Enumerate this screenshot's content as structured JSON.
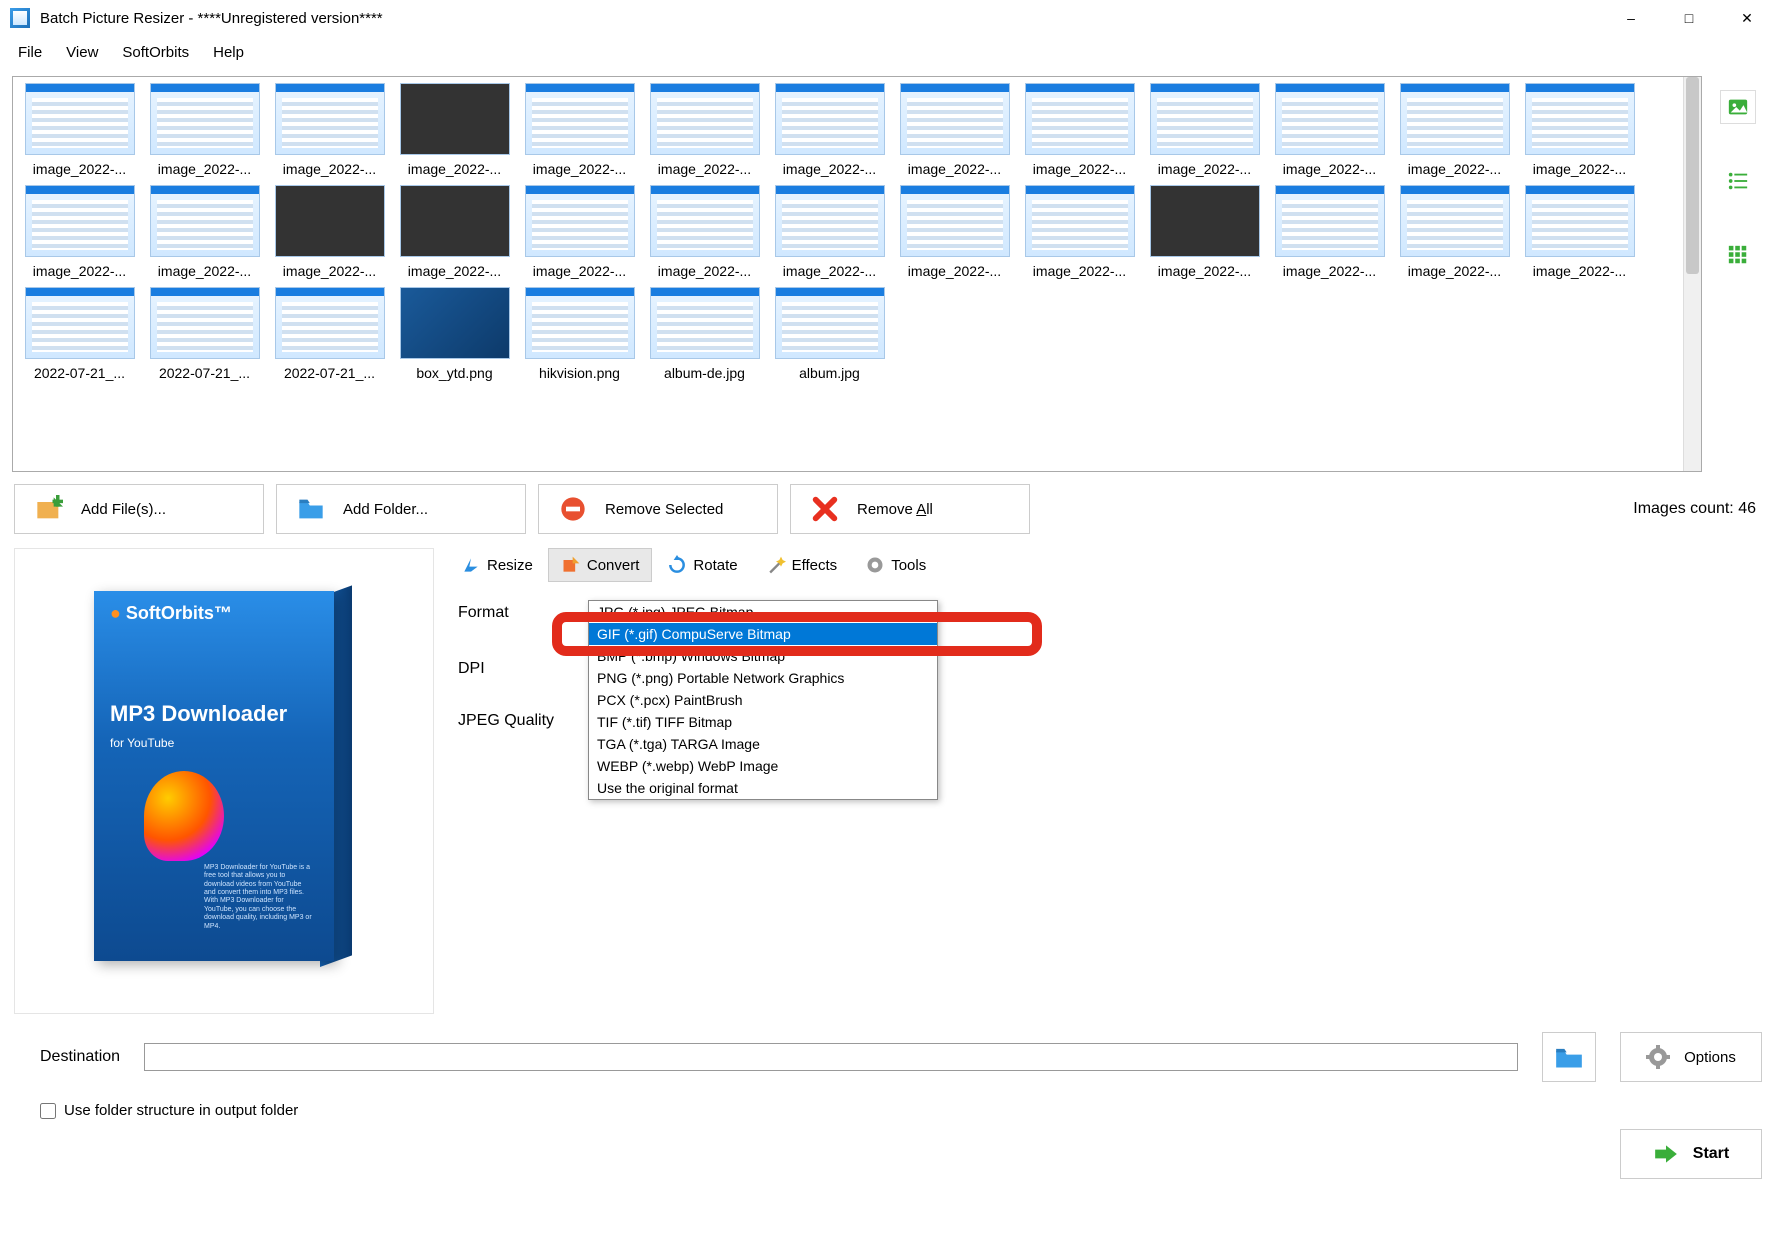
{
  "title": "Batch Picture Resizer - ****Unregistered version****",
  "menus": {
    "file": "File",
    "view": "View",
    "softorbits": "SoftOrbits",
    "help": "Help"
  },
  "thumbs_row1": [
    "image_2022-...",
    "image_2022-...",
    "image_2022-...",
    "image_2022-...",
    "image_2022-...",
    "image_2022-...",
    "image_2022-...",
    "image_2022-...",
    "image_2022-...",
    "image_2022-...",
    "image_2022-...",
    "image_2022-...",
    "image_2022-..."
  ],
  "thumbs_row2": [
    "image_2022-...",
    "image_2022-...",
    "image_2022-...",
    "image_2022-...",
    "image_2022-...",
    "image_2022-...",
    "image_2022-...",
    "image_2022-...",
    "image_2022-...",
    "image_2022-...",
    "image_2022-...",
    "image_2022-...",
    "image_2022-..."
  ],
  "thumbs_row3": [
    "2022-07-21_...",
    "2022-07-21_...",
    "2022-07-21_...",
    "box_ytd.png",
    "hikvision.png",
    "album-de.jpg",
    "album.jpg"
  ],
  "actions": {
    "add_files": "Add File(s)...",
    "add_folder": "Add Folder...",
    "remove_selected": "Remove Selected",
    "remove_all_prefix": "Remove ",
    "remove_all_u": "A",
    "remove_all_suffix": "ll"
  },
  "count_label": "Images count: 46",
  "tabs": {
    "resize": "Resize",
    "convert": "Convert",
    "rotate": "Rotate",
    "effects": "Effects",
    "tools": "Tools"
  },
  "labels": {
    "format": "Format",
    "dpi": "DPI",
    "jpeg": "JPEG Quality"
  },
  "combo_selected": "Use the original format",
  "dropdown": [
    "JPG (*.jpg) JPEG Bitmap",
    "GIF (*.gif) CompuServe Bitmap",
    "BMP (*.bmp) Windows Bitmap",
    "PNG (*.png) Portable Network Graphics",
    "PCX (*.pcx) PaintBrush",
    "TIF (*.tif) TIFF Bitmap",
    "TGA (*.tga) TARGA Image",
    "WEBP (*.webp) WebP Image",
    "Use the original format"
  ],
  "highlight_index": 1,
  "box": {
    "brand": "SoftOrbits™",
    "title": "MP3 Downloader",
    "subtitle": "for YouTube",
    "desc": "MP3 Downloader for YouTube is a free tool that allows you to download videos from YouTube and convert them into MP3 files. With MP3 Downloader for YouTube, you can choose the download quality, including MP3 or MP4."
  },
  "dest": {
    "label": "Destination",
    "checkbox": "Use folder structure in output folder"
  },
  "options": "Options",
  "start": "Start"
}
